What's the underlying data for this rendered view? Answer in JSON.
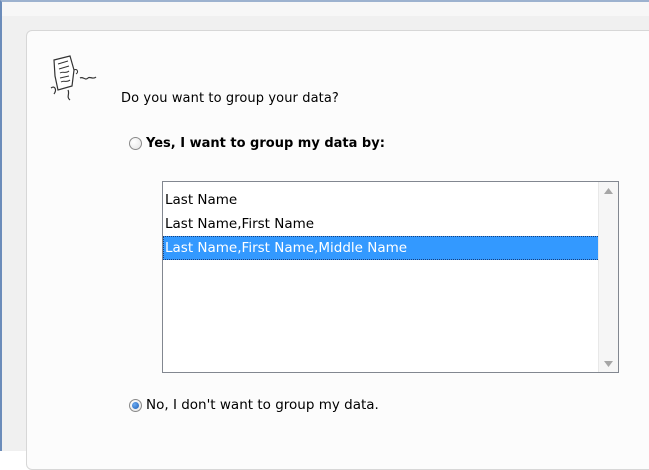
{
  "wizard": {
    "question": "Do you want to group your data?",
    "icon": "wizard-document-icon"
  },
  "options": {
    "yes_label": "Yes, I want to group my data by:",
    "yes_checked": false,
    "no_label": "No, I don't want to group my data.",
    "no_checked": true
  },
  "group_list": {
    "items": [
      "Last Name",
      "Last Name,First Name",
      "Last Name,First Name,Middle Name"
    ],
    "selected_index": 2
  },
  "colors": {
    "selection": "#3399ff",
    "frame_border": "#6b8cba",
    "panel_background": "#fcfcfc"
  }
}
